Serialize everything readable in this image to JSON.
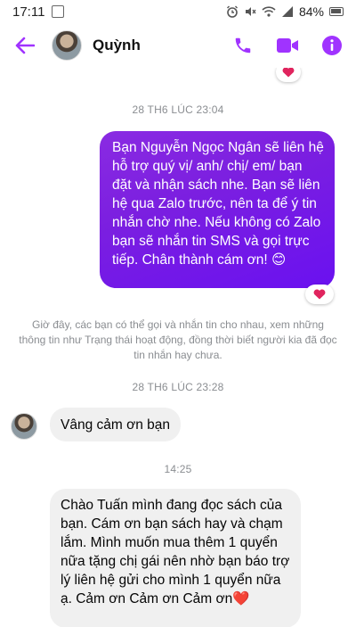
{
  "status_bar": {
    "time": "17:11",
    "battery_percent": "84%",
    "icons": [
      "alarm-icon",
      "mute-icon",
      "wifi-icon",
      "signal-icon",
      "battery-icon"
    ]
  },
  "header": {
    "contact_name": "Quỳnh",
    "accent_color": "#a033ff",
    "actions": [
      "phone-icon",
      "video-icon",
      "info-icon"
    ]
  },
  "chat": {
    "timestamp_1": "28 TH6 LÚC 23:04",
    "outgoing_message": "Bạn Nguyễn Ngọc Ngân sẽ liên hệ hỗ trợ quý vị/ anh/ chị/ em/ bạn đặt và nhận sách nhe. Bạn sẽ liên hệ qua Zalo trước, nên ta để ý tin nhắn chờ nhe. Nếu không có Zalo bạn sẽ nhắn tin SMS và gọi trực tiếp. Chân thành cám ơn! 😊",
    "system_note": "Giờ đây, các bạn có thể gọi và nhắn tin cho nhau, xem những thông tin như Trạng thái hoạt động, đồng thời biết người kia đã đọc tin nhắn hay chưa.",
    "timestamp_2": "28 TH6 LÚC 23:28",
    "incoming_message_1": "Vâng cảm ơn bạn",
    "timestamp_3": "14:25",
    "incoming_message_2": "Chào Tuấn mình đang đọc sách của bạn. Cám ơn bạn sách hay và chạm lắm. Mình muốn mua thêm 1 quyển nữa tặng chị gái nên nhờ bạn báo trợ lý liên hệ gửi cho mình 1 quyển nữa ạ. Cảm ơn Cảm ơn Cảm ơn❤️",
    "outgoing_bubble_color": "#7b1fe0",
    "incoming_bubble_color": "#f0f0f0",
    "reaction_color": "#e0245e"
  }
}
